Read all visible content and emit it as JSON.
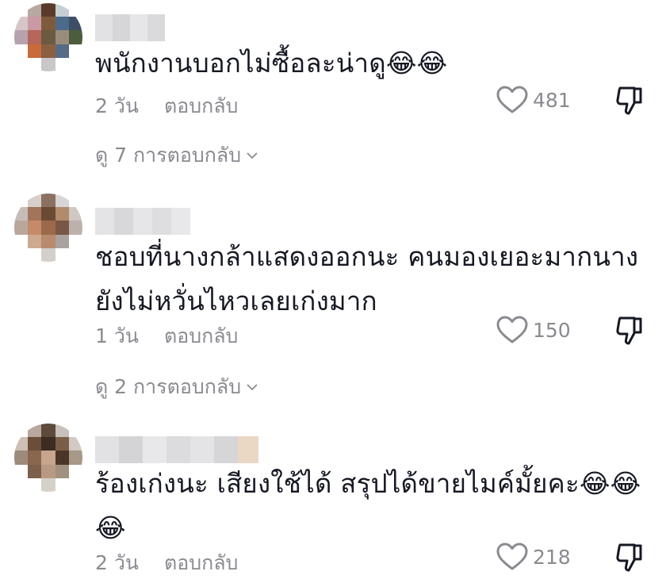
{
  "comments": [
    {
      "text": "พนักงานบอกไม่ซื้อละน่าดู😂😂",
      "time": "2 วัน",
      "reply_label": "ตอบกลับ",
      "likes": "481",
      "view_replies": "ดู 7 การตอบกลับ"
    },
    {
      "text_line1": "ชอบที่นางกล้าแสดงออกนะ คนมองเยอะมากนาง",
      "text_line2": "ยังไม่หวั่นไหวเลยเก่งมาก",
      "time": "1 วัน",
      "reply_label": "ตอบกลับ",
      "likes": "150",
      "view_replies": "ดู 2 การตอบกลับ"
    },
    {
      "text_line1": "ร้องเก่งนะ เสียงใช้ได้ สรุปได้ขายไมค์มั้ยคะ😂😂",
      "text_line2": "😂",
      "time": "2 วัน",
      "reply_label": "ตอบกลับ",
      "likes": "218"
    }
  ],
  "icons": {
    "like": "heart-outline-icon",
    "dislike": "thumbs-down-icon",
    "expand": "chevron-down-icon"
  },
  "colors": {
    "text": "#161823",
    "secondary": "#8a8b91",
    "background": "#ffffff"
  }
}
